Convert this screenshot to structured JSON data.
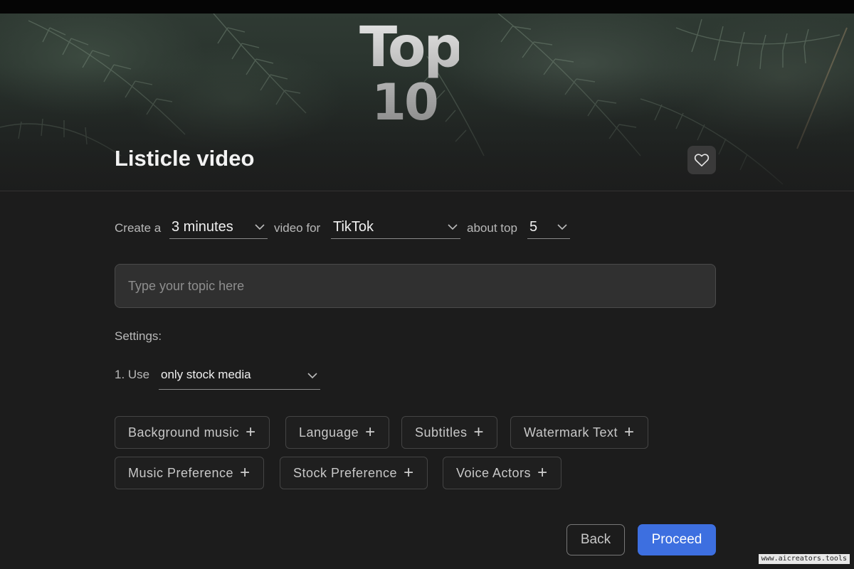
{
  "hero": {
    "badge_line1": "Top",
    "badge_line2": "10"
  },
  "header": {
    "title": "Listicle video",
    "favorite_icon": "heart-icon"
  },
  "config": {
    "create_label": "Create a",
    "duration_value": "3 minutes",
    "video_for_label": "video for",
    "platform_value": "TikTok",
    "about_top_label": "about top",
    "count_value": "5"
  },
  "topic": {
    "placeholder": "Type your topic here",
    "value": ""
  },
  "settings": {
    "label": "Settings:",
    "use_label": "1. Use",
    "media_value": "only stock media"
  },
  "options": [
    {
      "label": "Background music"
    },
    {
      "label": "Language"
    },
    {
      "label": "Subtitles"
    },
    {
      "label": "Watermark Text"
    },
    {
      "label": "Music Preference"
    },
    {
      "label": "Stock Preference"
    },
    {
      "label": "Voice Actors"
    }
  ],
  "actions": {
    "back_label": "Back",
    "proceed_label": "Proceed"
  },
  "watermark": "www.aicreators.tools",
  "colors": {
    "background": "#1c1c1c",
    "accent": "#3d6fe0",
    "input_bg": "#303030"
  }
}
